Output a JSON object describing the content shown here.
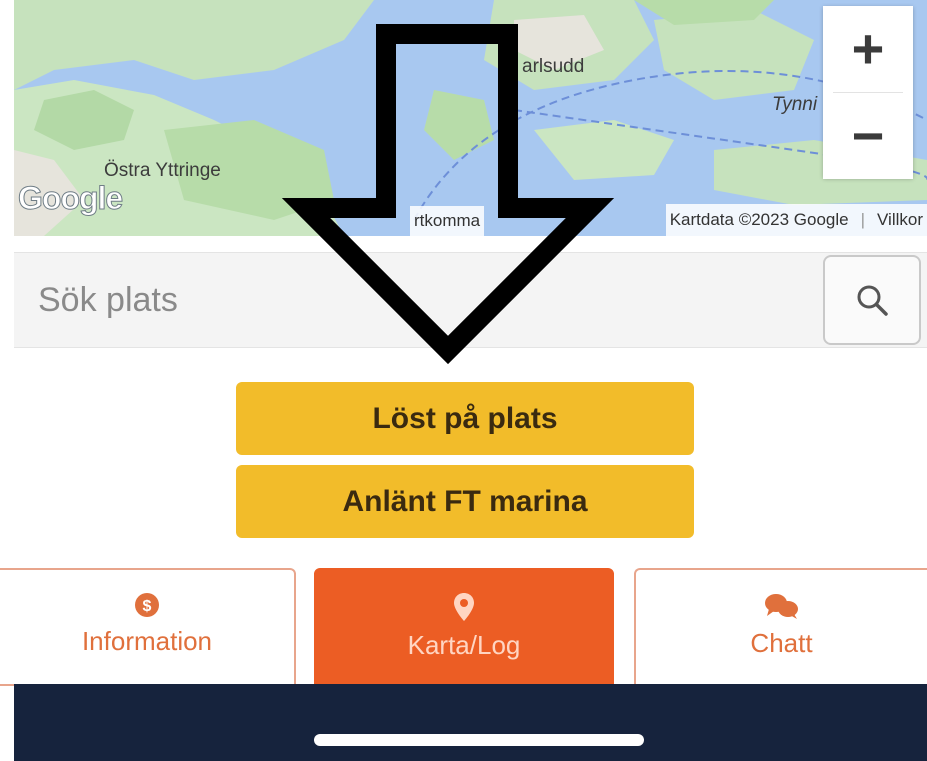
{
  "map": {
    "labels": {
      "karlsudd": "arlsudd",
      "tynning": "Tynni",
      "ostra": "Östra Yttringe"
    },
    "google_logo": "Google",
    "kortkommandon": "rtkomma",
    "attribution": "Kartdata ©2023 Google",
    "terms": "Villkor",
    "zoom_in": "+",
    "zoom_out": "−",
    "colors": {
      "water": "#a8c8f0",
      "land": "#c8e6c0",
      "urban": "#e8e6e0"
    }
  },
  "search": {
    "placeholder": "Sök plats",
    "icon": "search-icon"
  },
  "actions": {
    "primary": "Löst på plats",
    "secondary": "Anlänt FT marina",
    "color": "#f2bc2a"
  },
  "tabs": [
    {
      "label": "Information",
      "icon": "info-icon"
    },
    {
      "label": "Karta/Log",
      "icon": "map-pin-icon",
      "active": true
    },
    {
      "label": "Chatt",
      "icon": "chat-icon"
    }
  ],
  "overlay": {
    "icon": "down-arrow-annotation-icon"
  },
  "theme": {
    "accent": "#ec5d24",
    "nav_bg": "#16233d"
  }
}
